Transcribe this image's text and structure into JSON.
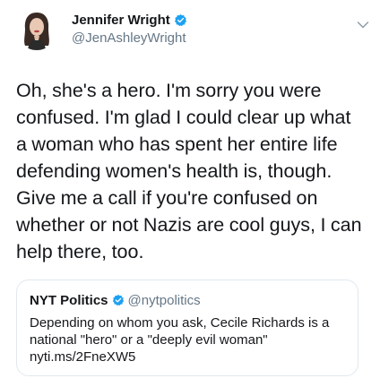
{
  "author": {
    "display_name": "Jennifer Wright",
    "handle": "@JenAshleyWright",
    "verified": true
  },
  "tweet": {
    "text": "Oh, she's a hero. I'm sorry you were confused. I'm glad I could clear up what a woman who has spent her entire life defending women's health is, though. Give me a call if you're confused on whether or not Nazis are cool guys, I can help there, too."
  },
  "quoted_tweet": {
    "display_name": "NYT Politics",
    "handle": "@nytpolitics",
    "verified": true,
    "text": "Depending on whom you ask, Cecile Richards is a national \"hero\" or a \"deeply evil woman\"",
    "link": "nyti.ms/2FneXW5"
  },
  "colors": {
    "verified_blue": "#1da1f2",
    "text_primary": "#14171a",
    "text_secondary": "#657786",
    "card_border": "#e1e8ed"
  },
  "icons": {
    "verified": "verified-badge-icon",
    "caret": "chevron-down-icon",
    "avatar": "user-avatar"
  }
}
